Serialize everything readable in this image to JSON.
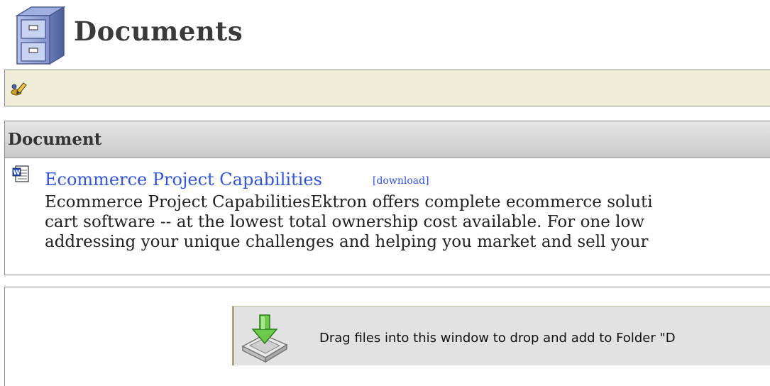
{
  "header": {
    "title": "Documents",
    "icon": "file-cabinet-icon"
  },
  "toolbar": {
    "edit_icon": "edit-pencil-icon"
  },
  "document_list": {
    "column_header": "Document",
    "items": [
      {
        "icon": "word-document-icon",
        "title": "Ecommerce Project Capabilities",
        "download_label": "[download]",
        "description_lines": [
          "Ecommerce Project CapabilitiesEktron offers complete ecommerce soluti",
          "cart software -- at the lowest total ownership cost available. For one low",
          "addressing your unique challenges and helping you market and sell your"
        ]
      }
    ]
  },
  "drop_zone": {
    "icon": "download-tray-icon",
    "text": "Drag files into this window to drop and add to Folder \"D"
  },
  "colors": {
    "link": "#3355dd",
    "toolbar_bg": "#eeeed8",
    "drop_zone_bg": "#e2e2e2"
  }
}
